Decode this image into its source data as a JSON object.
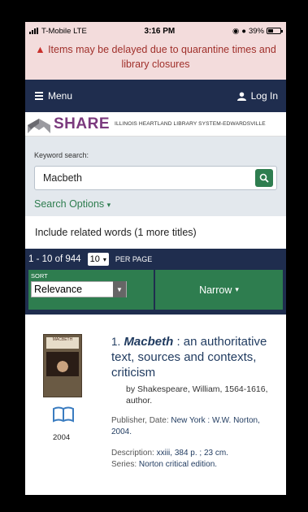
{
  "status": {
    "carrier": "T-Mobile  LTE",
    "time": "3:16 PM",
    "battery": "39%"
  },
  "alert": {
    "text": "Items may be delayed due to quarantine times and library closures"
  },
  "nav": {
    "menu_label": "Menu",
    "login_label": "Log In"
  },
  "brand": {
    "name": "SHARE",
    "system": "ILLINOIS HEARTLAND LIBRARY SYSTEM-EDWARDSVILLE"
  },
  "search": {
    "label": "Keyword search:",
    "value": "Macbeth",
    "options_label": "Search Options"
  },
  "related": {
    "text": "Include related words (1 more titles)"
  },
  "results": {
    "range": "1 - 10 of 944",
    "per_page_value": "10",
    "per_page_label": "PER PAGE",
    "sort_label": "SORT",
    "sort_value": "Relevance",
    "narrow_label": "Narrow"
  },
  "item": {
    "number": "1.",
    "title_main": "Macbeth",
    "title_rest": " : an authoritative text, sources and contexts, criticism",
    "by_label": "by",
    "author": "Shakespeare, William, 1564-1616, author.",
    "year": "2004",
    "publisher_label": "Publisher, Date:",
    "publisher_value": "New York : W.W. Norton, 2004.",
    "description_label": "Description:",
    "description_value": "xxiii, 384 p. ; 23 cm.",
    "series_label": "Series:",
    "series_value": "Norton critical edition.",
    "cover_text": "MACBETH"
  },
  "colors": {
    "navy": "#1f2d4e",
    "green": "#2e7d4f",
    "alert_bg": "#f3dcdc",
    "brand_purple": "#7b3a7e"
  }
}
